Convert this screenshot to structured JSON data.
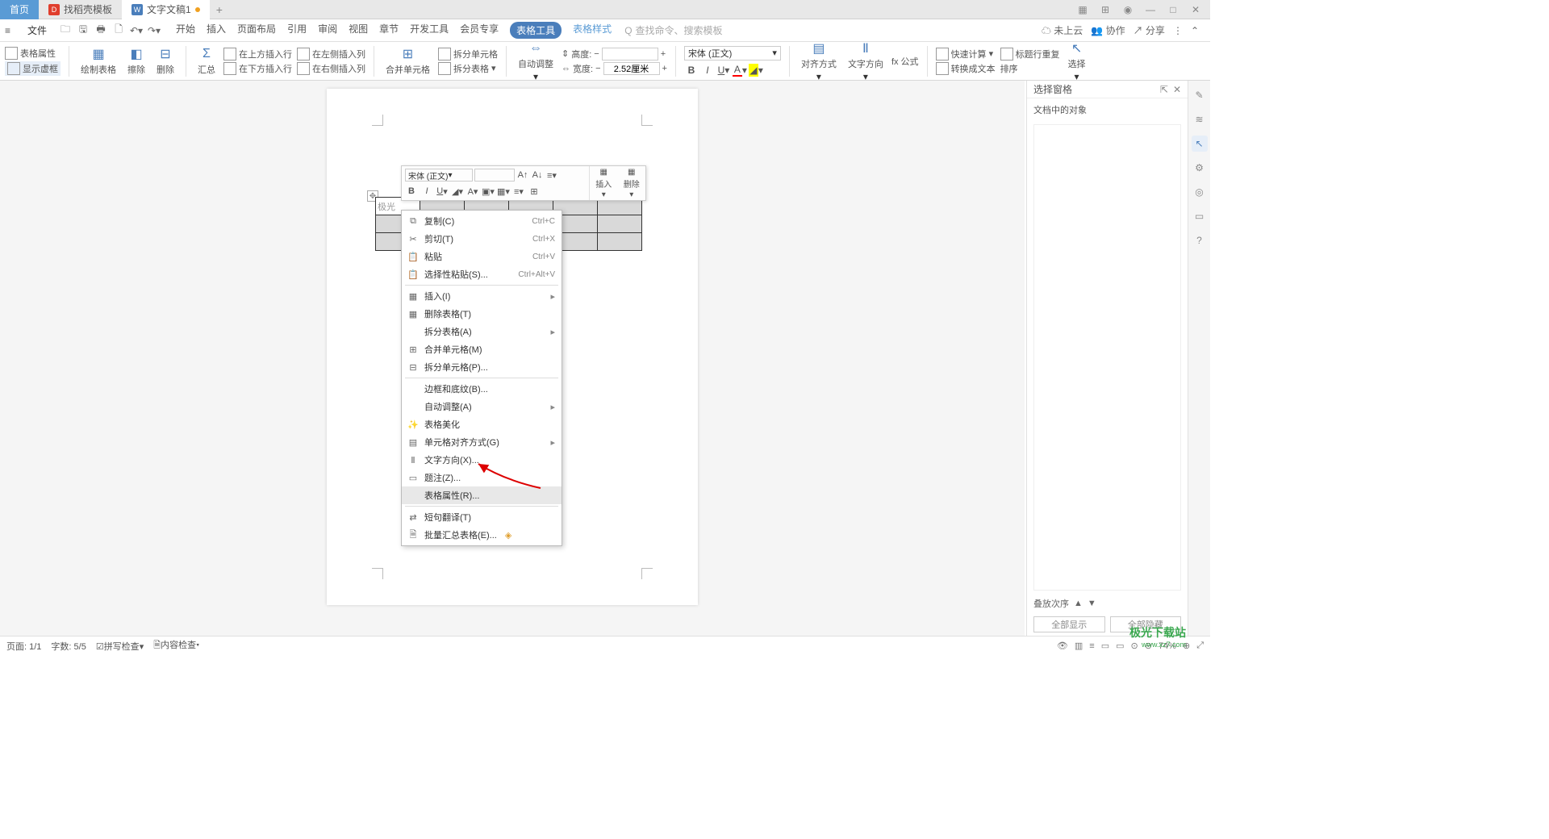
{
  "tabs": {
    "home": "首页",
    "t1": "找稻壳模板",
    "t2": "文字文稿1",
    "add": "+"
  },
  "win": {
    "grid": "▦",
    "apps": "⊞",
    "user": "◉",
    "min": "—",
    "max": "□",
    "close": "✕"
  },
  "menubar": {
    "file": "文件",
    "items": [
      "开始",
      "插入",
      "页面布局",
      "引用",
      "审阅",
      "视图",
      "章节",
      "开发工具",
      "会员专享"
    ],
    "active": "表格工具",
    "link": "表格样式",
    "search_placeholder": "查找命令、搜索模板",
    "search_icon": "Q",
    "cloud": "未上云",
    "coop": "协作",
    "share": "分享"
  },
  "ribbon": {
    "props": "表格属性",
    "vframe": "显示虚框",
    "draw": "绘制表格",
    "erase": "擦除",
    "delete": "删除",
    "sum": "汇总",
    "ins_above": "在上方插入行",
    "ins_below": "在下方插入行",
    "ins_left": "在左侧插入列",
    "ins_right": "在右侧插入列",
    "merge": "合并单元格",
    "split_cell": "拆分单元格",
    "split_table": "拆分表格",
    "autofit": "自动调整",
    "height_l": "高度:",
    "width_l": "宽度:",
    "width_v": "2.52厘米",
    "font": "宋体 (正文)",
    "align": "对齐方式",
    "textdir": "文字方向",
    "fx": "fx 公式",
    "quickcalc": "快速计算",
    "headrepeat": "标题行重复",
    "totext": "转换成文本",
    "sort": "排序",
    "select": "选择"
  },
  "minitoolbar": {
    "font": "宋体 (正文)",
    "insert": "插入",
    "delete": "删除"
  },
  "table_first_cell": "极光",
  "ctx": {
    "copy": {
      "l": "复制(C)",
      "s": "Ctrl+C"
    },
    "cut": {
      "l": "剪切(T)",
      "s": "Ctrl+X"
    },
    "paste": {
      "l": "粘贴",
      "s": "Ctrl+V"
    },
    "pastesp": {
      "l": "选择性粘贴(S)...",
      "s": "Ctrl+Alt+V"
    },
    "insert": "插入(I)",
    "deltable": "删除表格(T)",
    "splittbl": "拆分表格(A)",
    "mergecell": "合并单元格(M)",
    "splitcell": "拆分单元格(P)...",
    "borders": "边框和底纹(B)...",
    "autofit": "自动调整(A)",
    "beautify": "表格美化",
    "cellalign": "单元格对齐方式(G)",
    "textdir": "文字方向(X)...",
    "caption": "题注(Z)...",
    "tblprops": "表格属性(R)...",
    "translate": "短句翻译(T)",
    "batchsum": "批量汇总表格(E)..."
  },
  "rightpanel": {
    "title": "选择窗格",
    "subtitle": "文档中的对象",
    "stack": "叠放次序",
    "showall": "全部显示",
    "hideall": "全部隐藏"
  },
  "status": {
    "page": "页面: 1/1",
    "chars": "字数: 5/5",
    "spell": "拼写检查",
    "content": "内容检查",
    "zoom": "74%"
  },
  "watermark": {
    "t1": "极光下载站",
    "t2": "www.xz7.com"
  }
}
